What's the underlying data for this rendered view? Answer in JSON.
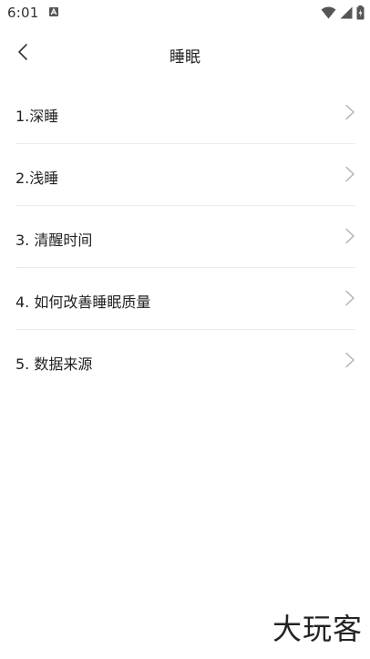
{
  "status_bar": {
    "time": "6:01",
    "icons": [
      "notification-a-icon",
      "wifi-icon",
      "signal-icon",
      "battery-icon"
    ]
  },
  "header": {
    "back_icon": "chevron-left-icon",
    "title": "睡眠"
  },
  "items": [
    {
      "label": "1.深睡"
    },
    {
      "label": "2.浅睡"
    },
    {
      "label": "3. 清醒时间"
    },
    {
      "label": "4. 如何改善睡眠质量"
    },
    {
      "label": "5. 数据来源"
    }
  ],
  "watermark": "大玩客",
  "colors": {
    "background": "#ffffff",
    "text": "#222222",
    "divider": "#ececec",
    "chevron": "#b5b5b5"
  }
}
